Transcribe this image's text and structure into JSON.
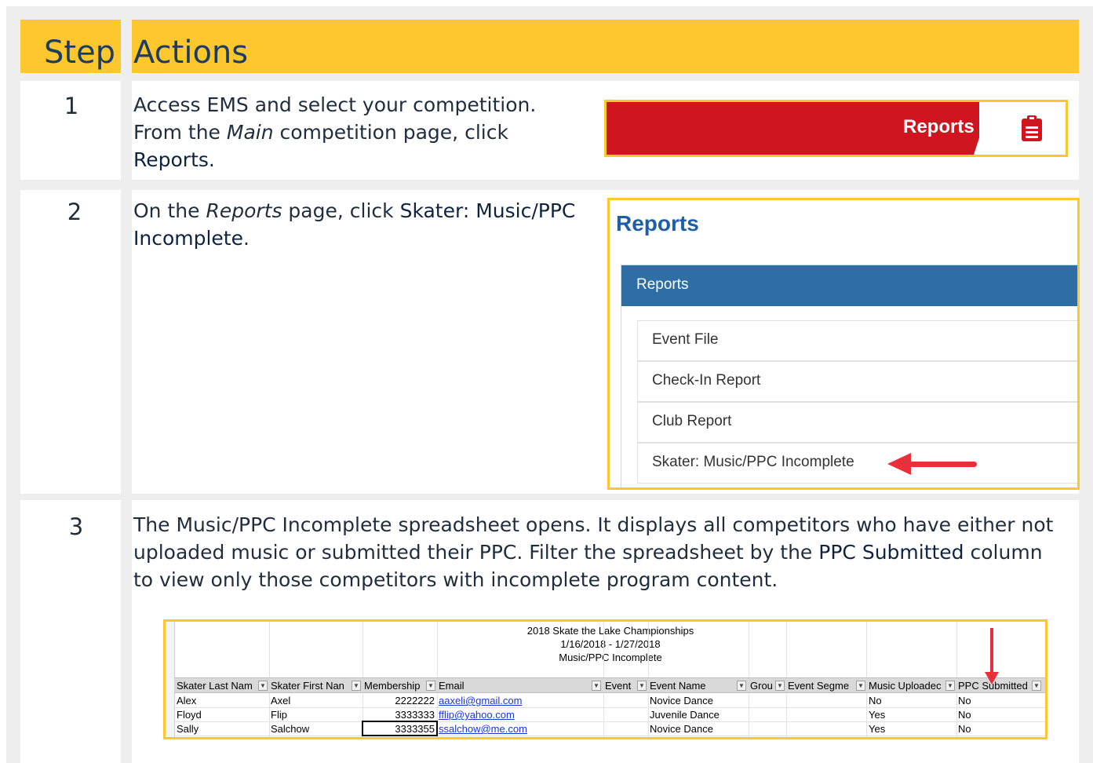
{
  "header": {
    "step": "Step",
    "actions": "Actions"
  },
  "rows": [
    {
      "num": "1",
      "text": {
        "a": "Access EMS and select your competition.",
        "b": "From the ",
        "b_em": "Main",
        "b2": " competition page, click",
        "c_bold": "Reports."
      },
      "image": {
        "label": "Reports",
        "icon": "clipboard-icon"
      }
    },
    {
      "num": "2",
      "text": {
        "a": "On the ",
        "a_em": "Reports",
        "a2": " page, click ",
        "a_bold": "Skater: Music/PPC",
        "b_bold": "Incomplete",
        "b2": "."
      },
      "image": {
        "title": "Reports",
        "panel_header": "Reports",
        "items": [
          "Event File",
          "Check-In Report",
          "Club Report",
          "Skater: Music/PPC Incomplete"
        ]
      }
    },
    {
      "num": "3",
      "text": {
        "l1": "The Music/PPC Incomplete spreadsheet opens.  It displays all competitors who have either not",
        "l2a": "uploaded music or submitted their PPC.  Filter the spreadsheet by the ",
        "l2_bold": "PPC Submitted",
        "l2b": " column",
        "l3": "to view only those competitors with incomplete program content."
      },
      "sheet": {
        "title1": "2018 Skate the Lake Championships",
        "title2": "1/16/2018 - 1/27/2018",
        "title3": "Music/PPC Incomplete",
        "headers": [
          "Skater Last Nam",
          "Skater First Nan",
          "Membership",
          "Email",
          "Event",
          "Event Name",
          "Grou",
          "Event Segme",
          "Music Uploadec",
          "PPC Submitted"
        ],
        "data": [
          [
            "Alex",
            "Axel",
            "2222222",
            "aaxeli@gmail.com",
            "",
            "Novice Dance",
            "",
            "",
            "No",
            "No"
          ],
          [
            "Floyd",
            "Flip",
            "3333333",
            "fflip@yahoo.com",
            "",
            "Juvenile Dance",
            "",
            "",
            "Yes",
            "No"
          ],
          [
            "Sally",
            "Salchow",
            "3333355",
            "ssalchow@me.com",
            "",
            "Novice Dance",
            "",
            "",
            "Yes",
            "No"
          ]
        ]
      }
    }
  ],
  "colors": {
    "header_bg": "#fec72e",
    "reports_red": "#cf1520",
    "panel_blue": "#2f6ea5",
    "arrow_red": "#e8303a"
  }
}
